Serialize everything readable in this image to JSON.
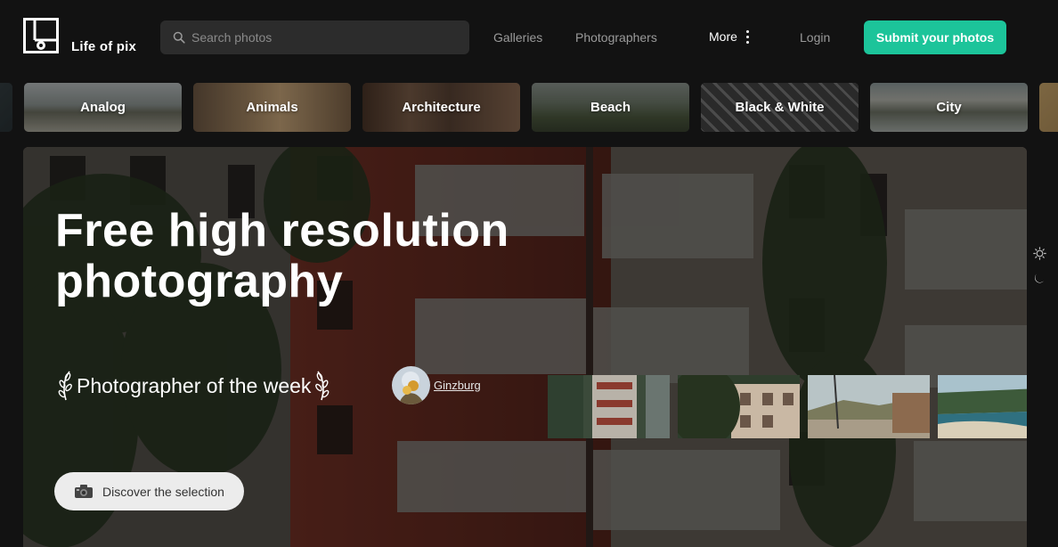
{
  "brand": {
    "name": "Life of pix",
    "logo_icon": "life-of-pix-logo"
  },
  "search": {
    "placeholder": "Search photos",
    "icon": "search-icon"
  },
  "nav": {
    "galleries": "Galleries",
    "photographers": "Photographers",
    "more": "More",
    "login": "Login",
    "submit": "Submit your photos"
  },
  "colors": {
    "accent": "#1cc49a",
    "background": "#121212",
    "search_bg": "#2c2c2c"
  },
  "categories": [
    {
      "label": "Analog"
    },
    {
      "label": "Animals"
    },
    {
      "label": "Architecture"
    },
    {
      "label": "Beach"
    },
    {
      "label": "Black & White"
    },
    {
      "label": "City"
    }
  ],
  "hero": {
    "title_line1": "Free high resolution",
    "title_line2": "photography",
    "photographer_of_week_label": "Photographer of the week",
    "photographer_name": "Ginzburg",
    "discover_label": "Discover the selection",
    "discover_icon": "camera-icon"
  },
  "theme": {
    "light_icon": "sun-icon",
    "dark_icon": "moon-icon"
  }
}
